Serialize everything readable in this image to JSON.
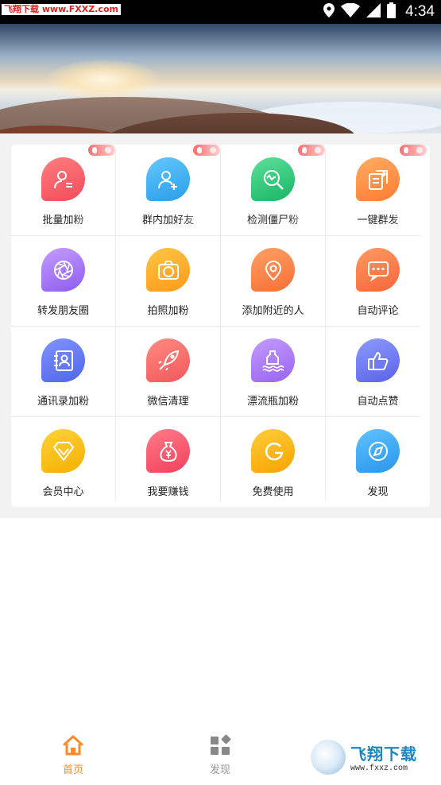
{
  "status_bar": {
    "watermark": "飞翔下载 www.FXXZ.com",
    "time": "4:34",
    "icons": [
      "location-icon",
      "wifi-icon",
      "signal-icon",
      "battery-icon"
    ]
  },
  "banner": {
    "alt": "mountain-sunrise-banner"
  },
  "grid": {
    "items": [
      {
        "label": "批量加粉",
        "icon": "user-list-icon",
        "color1": "#ff7e7e",
        "color2": "#f24b5a",
        "hot": true
      },
      {
        "label": "群内加好友",
        "icon": "add-user-icon",
        "color1": "#63c8ff",
        "color2": "#2a9de8",
        "hot": true
      },
      {
        "label": "检测僵尸粉",
        "icon": "magnifier-pulse-icon",
        "color1": "#5ee09a",
        "color2": "#18b565",
        "hot": true
      },
      {
        "label": "一键群发",
        "icon": "send-doc-icon",
        "color1": "#ffad62",
        "color2": "#ff7a32",
        "hot": true
      },
      {
        "label": "转发朋友圈",
        "icon": "aperture-icon",
        "color1": "#c59cff",
        "color2": "#8d5cf0",
        "hot": false
      },
      {
        "label": "拍照加粉",
        "icon": "camera-icon",
        "color1": "#ffc545",
        "color2": "#ff9a1a",
        "hot": false
      },
      {
        "label": "添加附近的人",
        "icon": "location-pin-icon",
        "color1": "#ffa065",
        "color2": "#f76f34",
        "hot": false
      },
      {
        "label": "自动评论",
        "icon": "comment-icon",
        "color1": "#ff9a62",
        "color2": "#f7653a",
        "hot": false
      },
      {
        "label": "通讯录加粉",
        "icon": "contacts-book-icon",
        "color1": "#7f93ff",
        "color2": "#5066e8",
        "hot": false
      },
      {
        "label": "微信清理",
        "icon": "rocket-icon",
        "color1": "#ff8a80",
        "color2": "#f2585c",
        "hot": false
      },
      {
        "label": "漂流瓶加粉",
        "icon": "bottle-icon",
        "color1": "#c19bff",
        "color2": "#9a64f0",
        "hot": false
      },
      {
        "label": "自动点赞",
        "icon": "thumbs-up-icon",
        "color1": "#8d9bff",
        "color2": "#5a62e6",
        "hot": false
      },
      {
        "label": "会员中心",
        "icon": "diamond-icon",
        "color1": "#ffd23a",
        "color2": "#f4b000",
        "hot": false
      },
      {
        "label": "我要赚钱",
        "icon": "money-bag-icon",
        "color1": "#ff7a8a",
        "color2": "#f2415a",
        "hot": false
      },
      {
        "label": "免费使用",
        "icon": "letter-g-icon",
        "color1": "#ffcd3a",
        "color2": "#f7a300",
        "hot": false
      },
      {
        "label": "发现",
        "icon": "compass-icon",
        "color1": "#5ec3ff",
        "color2": "#2a95ea",
        "hot": false
      }
    ]
  },
  "tabbar": {
    "tabs": [
      {
        "label": "首页",
        "icon": "home-icon",
        "active": true
      },
      {
        "label": "发现",
        "icon": "grid-shapes-icon",
        "active": false
      }
    ],
    "active_color": "#ff8a2b",
    "inactive_color": "#999999"
  },
  "bottom_watermark": {
    "title": "飞翔下载",
    "url": "www.fxxz.com"
  }
}
